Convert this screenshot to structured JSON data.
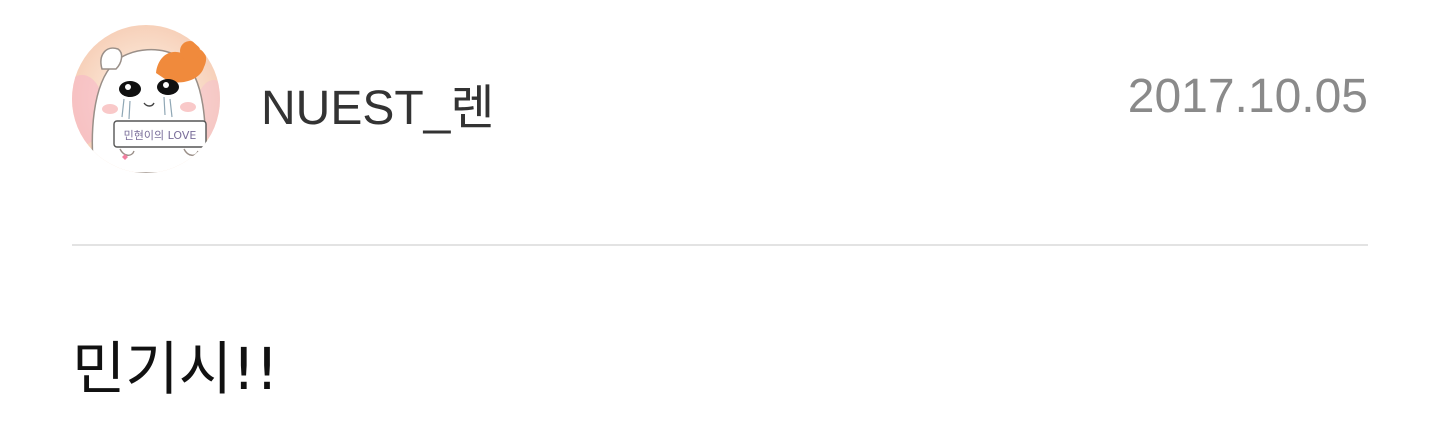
{
  "post": {
    "author": {
      "avatar_icon": "hamster-avatar-icon",
      "avatar_text": "민현이의 LOVE",
      "name": "NUEST_렌"
    },
    "date": "2017.10.05",
    "body_text": "민기시!!"
  },
  "colors": {
    "username": "#333333",
    "date": "#8a8a8a",
    "divider": "#e3e3e3",
    "body_text": "#111111",
    "avatar_accent": "#f08a3c"
  }
}
